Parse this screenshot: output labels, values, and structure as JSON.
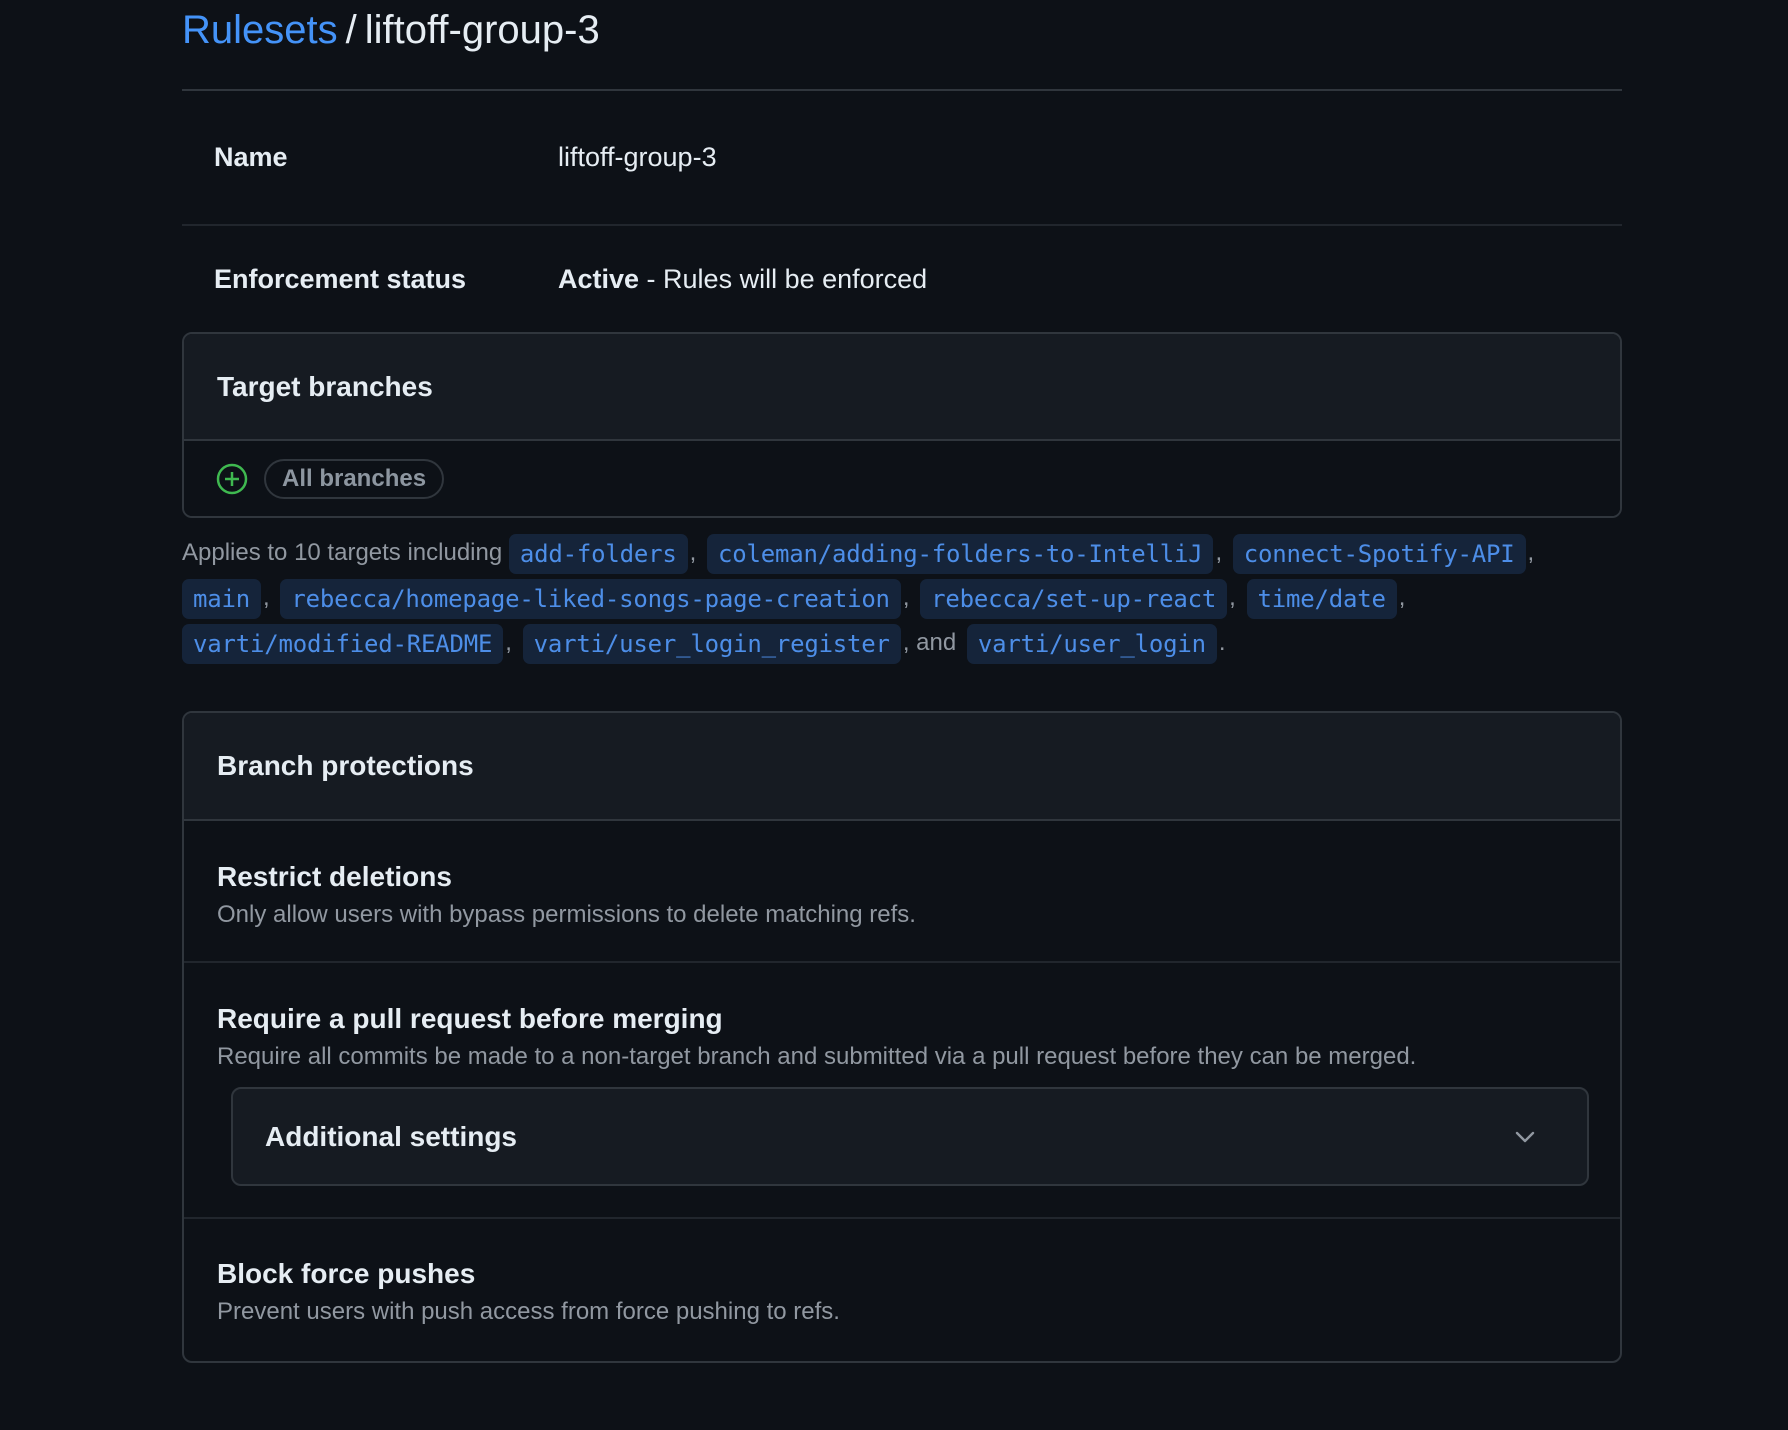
{
  "breadcrumb": {
    "root": "Rulesets",
    "separator": "/",
    "current": "liftoff-group-3"
  },
  "info": {
    "name_label": "Name",
    "name_value": "liftoff-group-3",
    "status_label": "Enforcement status",
    "status_value_strong": "Active",
    "status_value_rest": " - Rules will be enforced"
  },
  "target": {
    "title": "Target branches",
    "pill": "All branches",
    "icon": "plus-circle-icon",
    "applies_prefix": "Applies to 10 targets including",
    "branches": [
      "add-folders",
      "coleman/adding-folders-to-IntelliJ",
      "connect-Spotify-API",
      "main",
      "rebecca/homepage-liked-songs-page-creation",
      "rebecca/set-up-react",
      "time/date",
      "varti/modified-README",
      "varti/user_login_register",
      "varti/user_login"
    ],
    "comma": ",",
    "and": ", and",
    "period": "."
  },
  "protections": {
    "title": "Branch protections",
    "rules": [
      {
        "title": "Restrict deletions",
        "desc": "Only allow users with bypass permissions to delete matching refs."
      },
      {
        "title": "Require a pull request before merging",
        "desc": "Require all commits be made to a non-target branch and submitted via a pull request before they can be merged.",
        "additional_label": "Additional settings"
      },
      {
        "title": "Block force pushes",
        "desc": "Prevent users with push access from force pushing to refs."
      }
    ]
  },
  "colors": {
    "background": "#0d1117",
    "link": "#4493f8",
    "success": "#3fb950",
    "border": "#30363d"
  }
}
